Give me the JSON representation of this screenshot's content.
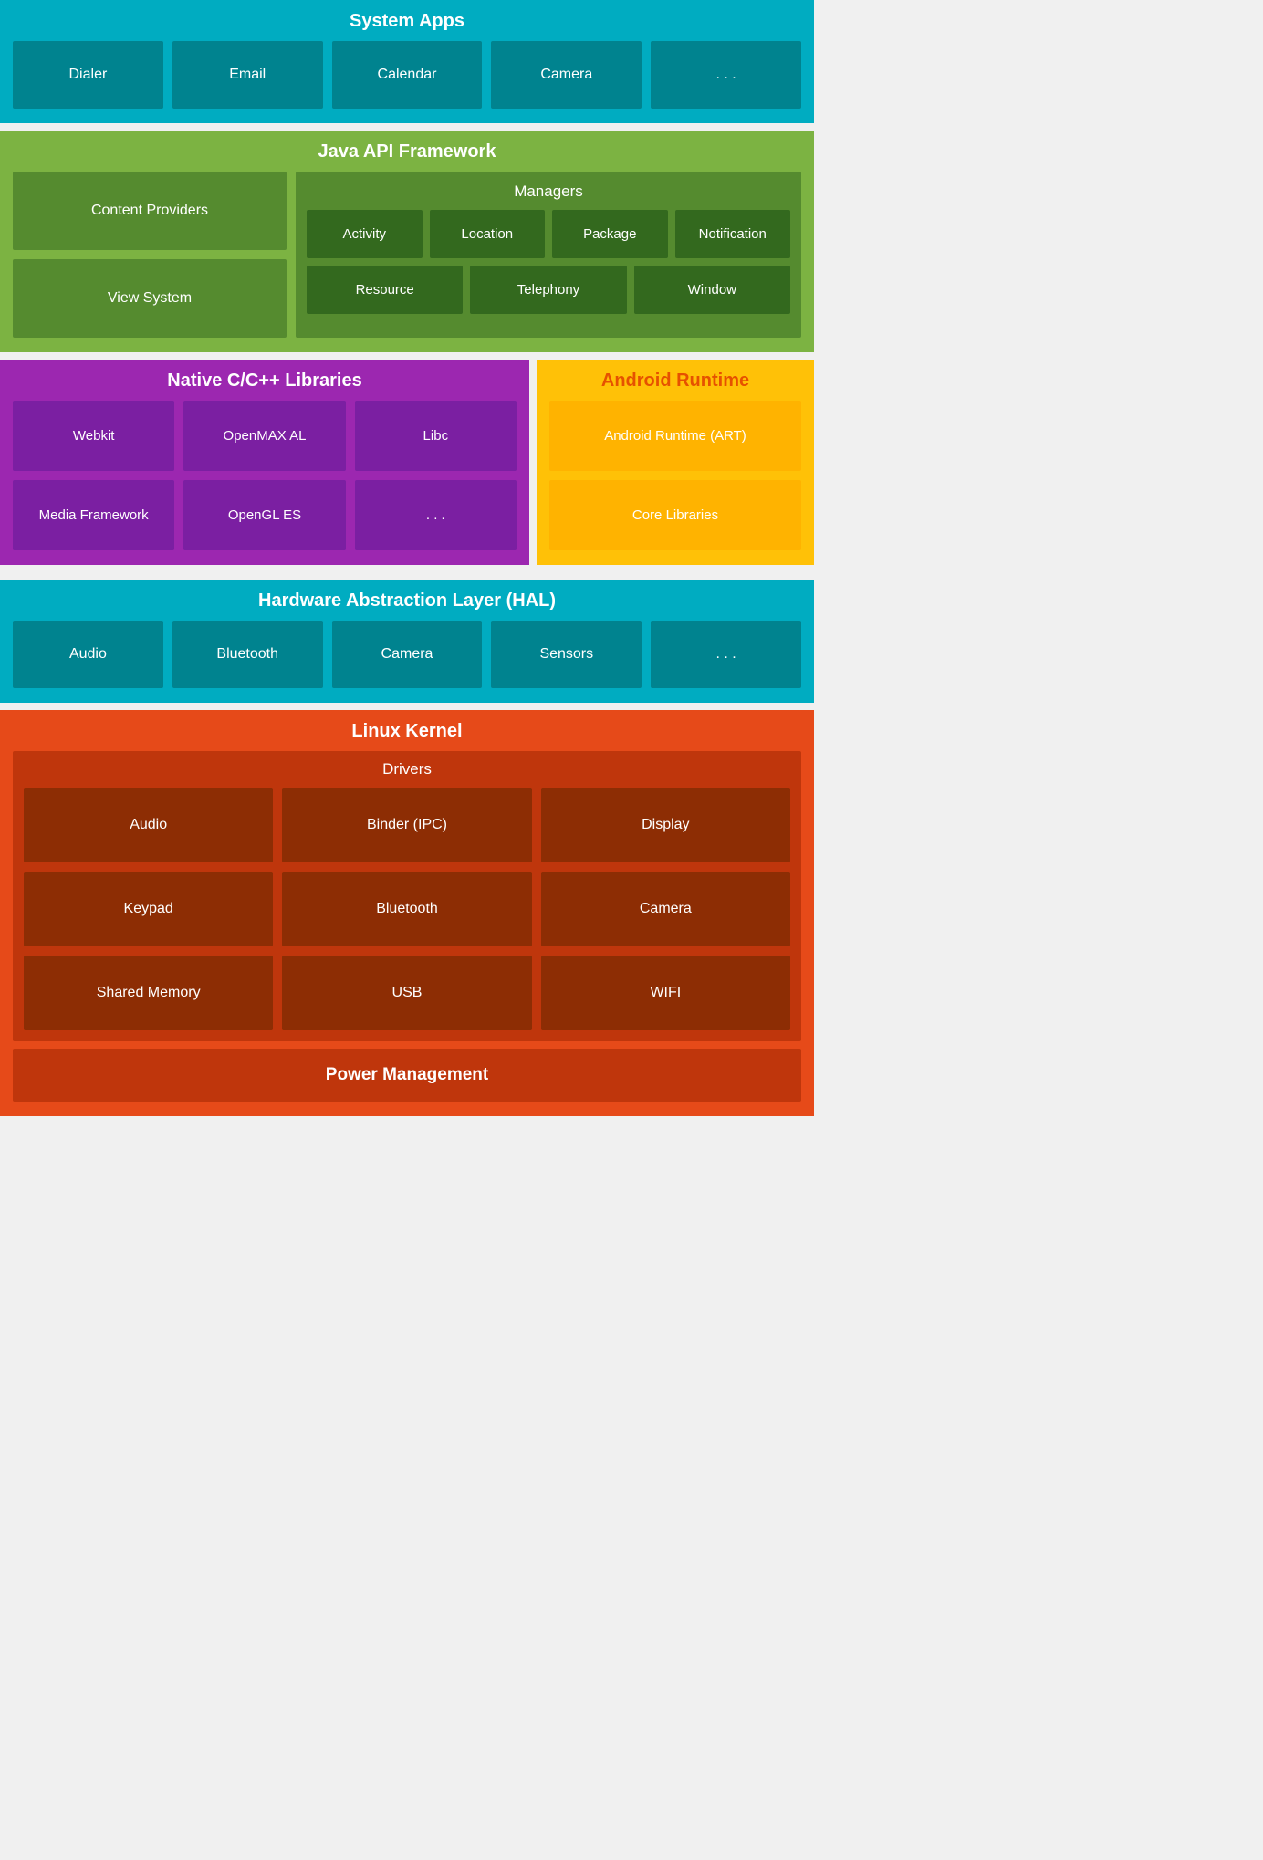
{
  "systemApps": {
    "title": "System Apps",
    "apps": [
      "Dialer",
      "Email",
      "Calendar",
      "Camera",
      ". . ."
    ]
  },
  "javaApi": {
    "title": "Java API Framework",
    "left": [
      "Content Providers",
      "View System"
    ],
    "managers": {
      "title": "Managers",
      "row1": [
        "Activity",
        "Location",
        "Package",
        "Notification"
      ],
      "row2": [
        "Resource",
        "Telephony",
        "Window"
      ]
    }
  },
  "nativeLibs": {
    "title": "Native C/C++ Libraries",
    "items": [
      "Webkit",
      "OpenMAX AL",
      "Libc",
      "Media Framework",
      "OpenGL ES",
      ". . ."
    ]
  },
  "androidRuntime": {
    "title": "Android Runtime",
    "items": [
      "Android Runtime (ART)",
      "Core Libraries"
    ]
  },
  "hal": {
    "title": "Hardware Abstraction Layer (HAL)",
    "items": [
      "Audio",
      "Bluetooth",
      "Camera",
      "Sensors",
      ". . ."
    ]
  },
  "linuxKernel": {
    "title": "Linux Kernel",
    "drivers": {
      "title": "Drivers",
      "items": [
        "Audio",
        "Binder (IPC)",
        "Display",
        "Keypad",
        "Bluetooth",
        "Camera",
        "Shared Memory",
        "USB",
        "WIFI"
      ]
    },
    "powerManagement": "Power Management"
  }
}
